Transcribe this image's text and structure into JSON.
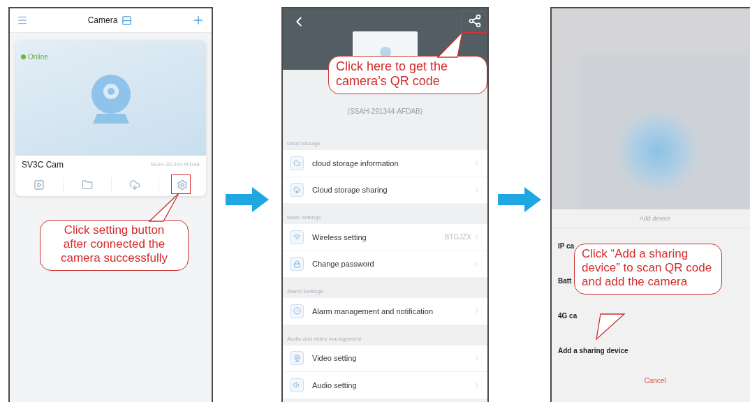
{
  "home_screen": {
    "title": "Camera",
    "camera": {
      "status": "Online",
      "name": "SV3C Cam",
      "id": "SSAH-291344-AFDAB"
    },
    "callout": "Click setting button after connected the camera successfully"
  },
  "settings_screen": {
    "device_id": "(SSAH-291344-AFDAB)",
    "callout": "Click here to get the camera’s QR code",
    "sections": [
      {
        "heading": "cloud storage",
        "items": [
          {
            "label": "cloud storage information"
          },
          {
            "label": "Cloud storage sharing"
          }
        ]
      },
      {
        "heading": "basic settings",
        "items": [
          {
            "label": "Wireless setting",
            "value": "BTGJZX"
          },
          {
            "label": "Change password"
          }
        ]
      },
      {
        "heading": "Alarm Settings",
        "items": [
          {
            "label": "Alarm management and notification"
          }
        ]
      },
      {
        "heading": "Audio and video management",
        "items": [
          {
            "label": "Video setting"
          },
          {
            "label": "Audio setting"
          }
        ]
      }
    ]
  },
  "add_device_screen": {
    "sheet_title": "Add device",
    "options": [
      {
        "label": "IP ca"
      },
      {
        "label": "Batt"
      },
      {
        "label": "4G ca"
      },
      {
        "label": "Add a sharing device"
      }
    ],
    "cancel": "Cancel",
    "callout": "Click “Add a sharing device” to scan QR code and add the camera"
  }
}
